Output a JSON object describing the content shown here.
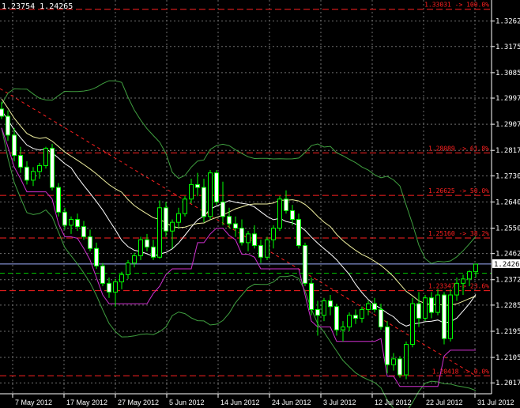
{
  "header": {
    "text": "1.23754 1.24265"
  },
  "colors": {
    "background": "#000000",
    "grid": "#707070",
    "axis_text": "#ffffff",
    "bull": "#00ff00",
    "bear": "#ffffff",
    "fib": "#ff2020",
    "bollinger_outer": "#40a040",
    "bollinger_mid": "#f0f0a0",
    "ma_slow": "#ffffff",
    "ma_magenta": "#d030d0",
    "price_line": "#a0b0ff"
  },
  "chart_data": {
    "type": "candlestick",
    "x_tick_labels": [
      "7 May 2012",
      "17 May 2012",
      "27 May 2012",
      "5 Jun 2012",
      "14 Jun 2012",
      "24 Jun 2012",
      "3 Jul 2012",
      "12 Jul 2012",
      "22 Jul 2012",
      "31 Jul 2012"
    ],
    "y_tick_labels": [
      "1.32625",
      "1.31750",
      "1.30850",
      "1.29975",
      "1.29075",
      "1.28175",
      "1.27300",
      "1.26400",
      "1.25500",
      "1.24625",
      "1.23725",
      "1.22850",
      "1.21950",
      "1.21050",
      "1.20175"
    ],
    "ylim": [
      1.198,
      1.3335
    ],
    "current_price": "1.24265",
    "fib_levels": [
      {
        "label": "1.33031 -> 100.0%",
        "price": 1.33031
      },
      {
        "label": "1.28089 -> 61.8%",
        "price": 1.28089
      },
      {
        "label": "1.26625 -> 50.0%",
        "price": 1.26625
      },
      {
        "label": "1.25160 -> 38.2%",
        "price": 1.2516
      },
      {
        "label": "1.23347 -> 23.6%",
        "price": 1.23347
      },
      {
        "label": "1.20418 -> 0.0%",
        "price": 1.20418
      }
    ],
    "candles": [
      [
        1.296,
        1.2985,
        1.2925,
        1.2935
      ],
      [
        1.2935,
        1.2955,
        1.285,
        1.287
      ],
      [
        1.287,
        1.2895,
        1.278,
        1.28
      ],
      [
        1.28,
        1.283,
        1.274,
        1.276
      ],
      [
        1.276,
        1.278,
        1.27,
        1.2715
      ],
      [
        1.2715,
        1.276,
        1.2695,
        1.2745
      ],
      [
        1.2745,
        1.2775,
        1.272,
        1.2765
      ],
      [
        1.2765,
        1.283,
        1.2755,
        1.2825
      ],
      [
        1.2825,
        1.284,
        1.268,
        1.269
      ],
      [
        1.269,
        1.2705,
        1.259,
        1.2605
      ],
      [
        1.2605,
        1.262,
        1.2545,
        1.256
      ],
      [
        1.256,
        1.259,
        1.253,
        1.258
      ],
      [
        1.258,
        1.26,
        1.254,
        1.2555
      ],
      [
        1.2555,
        1.2575,
        1.251,
        1.252
      ],
      [
        1.252,
        1.2545,
        1.247,
        1.248
      ],
      [
        1.248,
        1.25,
        1.241,
        1.242
      ],
      [
        1.242,
        1.243,
        1.235,
        1.236
      ],
      [
        1.236,
        1.238,
        1.231,
        1.233
      ],
      [
        1.233,
        1.2375,
        1.228,
        1.2365
      ],
      [
        1.2365,
        1.24,
        1.234,
        1.239
      ],
      [
        1.239,
        1.244,
        1.2375,
        1.243
      ],
      [
        1.243,
        1.2465,
        1.2415,
        1.2455
      ],
      [
        1.2455,
        1.252,
        1.244,
        1.251
      ],
      [
        1.251,
        1.253,
        1.247,
        1.2485
      ],
      [
        1.2485,
        1.251,
        1.244,
        1.245
      ],
      [
        1.245,
        1.2645,
        1.2445,
        1.262
      ],
      [
        1.262,
        1.264,
        1.252,
        1.254
      ],
      [
        1.254,
        1.258,
        1.248,
        1.257
      ],
      [
        1.257,
        1.262,
        1.255,
        1.26
      ],
      [
        1.26,
        1.266,
        1.259,
        1.265
      ],
      [
        1.265,
        1.272,
        1.2635,
        1.27
      ],
      [
        1.27,
        1.274,
        1.266,
        1.269
      ],
      [
        1.269,
        1.272,
        1.257,
        1.259
      ],
      [
        1.259,
        1.275,
        1.258,
        1.274
      ],
      [
        1.274,
        1.275,
        1.263,
        1.264
      ],
      [
        1.264,
        1.271,
        1.256,
        1.259
      ],
      [
        1.259,
        1.262,
        1.255,
        1.2565
      ],
      [
        1.2565,
        1.259,
        1.252,
        1.255
      ],
      [
        1.255,
        1.258,
        1.249,
        1.25
      ],
      [
        1.25,
        1.254,
        1.247,
        1.253
      ],
      [
        1.253,
        1.256,
        1.248,
        1.249
      ],
      [
        1.249,
        1.251,
        1.243,
        1.245
      ],
      [
        1.245,
        1.252,
        1.244,
        1.251
      ],
      [
        1.251,
        1.256,
        1.248,
        1.255
      ],
      [
        1.255,
        1.266,
        1.254,
        1.265
      ],
      [
        1.265,
        1.268,
        1.26,
        1.261
      ],
      [
        1.261,
        1.263,
        1.256,
        1.258
      ],
      [
        1.258,
        1.26,
        1.248,
        1.249
      ],
      [
        1.249,
        1.25,
        1.235,
        1.236
      ],
      [
        1.236,
        1.238,
        1.225,
        1.227
      ],
      [
        1.227,
        1.23,
        1.218,
        1.225
      ],
      [
        1.225,
        1.231,
        1.223,
        1.23
      ],
      [
        1.23,
        1.232,
        1.225,
        1.228
      ],
      [
        1.228,
        1.229,
        1.218,
        1.22
      ],
      [
        1.22,
        1.223,
        1.216,
        1.221
      ],
      [
        1.221,
        1.226,
        1.2195,
        1.225
      ],
      [
        1.225,
        1.227,
        1.222,
        1.224
      ],
      [
        1.224,
        1.228,
        1.2225,
        1.227
      ],
      [
        1.227,
        1.23,
        1.225,
        1.229
      ],
      [
        1.229,
        1.231,
        1.226,
        1.227
      ],
      [
        1.227,
        1.229,
        1.22,
        1.221
      ],
      [
        1.221,
        1.223,
        1.205,
        1.208
      ],
      [
        1.208,
        1.212,
        1.206,
        1.21
      ],
      [
        1.21,
        1.211,
        1.2035,
        1.2045
      ],
      [
        1.2045,
        1.216,
        1.203,
        1.215
      ],
      [
        1.215,
        1.231,
        1.214,
        1.229
      ],
      [
        1.229,
        1.233,
        1.221,
        1.224
      ],
      [
        1.224,
        1.232,
        1.223,
        1.231
      ],
      [
        1.231,
        1.233,
        1.224,
        1.226
      ],
      [
        1.226,
        1.234,
        1.225,
        1.232
      ],
      [
        1.232,
        1.233,
        1.215,
        1.217
      ],
      [
        1.217,
        1.234,
        1.216,
        1.232
      ],
      [
        1.232,
        1.238,
        1.23,
        1.236
      ],
      [
        1.236,
        1.239,
        1.232,
        1.2375
      ],
      [
        1.2375,
        1.2405,
        1.235,
        1.24
      ],
      [
        1.24,
        1.242,
        1.238,
        1.2426
      ]
    ]
  }
}
